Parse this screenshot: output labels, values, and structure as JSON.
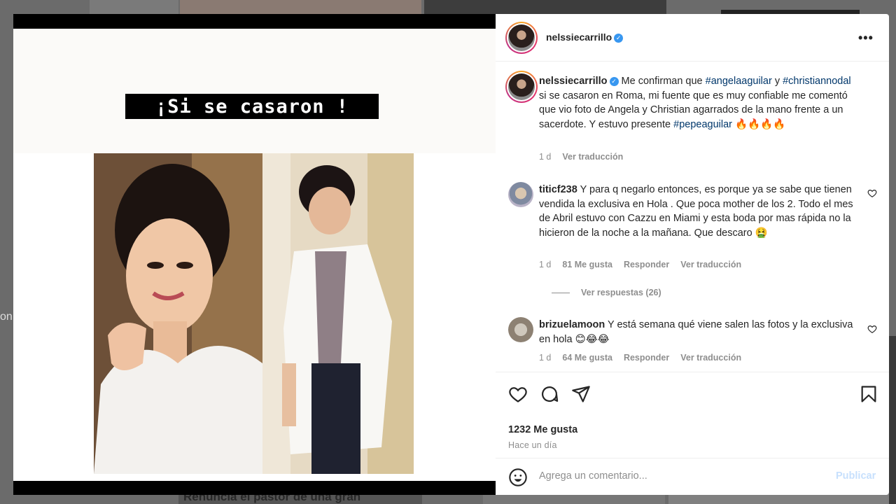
{
  "background": {
    "left_text": "on",
    "bottom_text": "Renuncia el pastor de una gran"
  },
  "media": {
    "story_caption": "¡Si se casaron !"
  },
  "post": {
    "author": "nelssiecarrillo",
    "caption": {
      "username": "nelssiecarrillo",
      "text_1": " Me confirman que ",
      "tag_1": "#angelaaguilar",
      "text_2": " y ",
      "tag_2": "#christiannodal",
      "text_3": " si se casaron en Roma, mi fuente que es muy confiable me comentó que vio foto de Angela y Christian agarrados de la mano frente a un sacerdote. Y estuvo presente ",
      "tag_3": "#pepeaguilar",
      "emoji": " 🔥🔥🔥🔥",
      "time": "1 d",
      "translate": "Ver traducción"
    },
    "comments": [
      {
        "username": "titicf238",
        "text": " Y para q negarlo entonces, es porque ya se sabe que tienen vendida la exclusiva en Hola . Que poca mother de los 2. Todo el mes de Abril estuvo con Cazzu en Miami y esta boda por mas rápida no la hicieron de la noche a la mañana. Que descaro 🤮",
        "time": "1 d",
        "likes": "81 Me gusta",
        "reply": "Responder",
        "translate": "Ver traducción",
        "view_replies": "Ver respuestas (26)"
      },
      {
        "username": "brizuelamoon",
        "text": " Y está semana qué viene salen las fotos y la exclusiva en hola 😊😂😂",
        "time": "1 d",
        "likes": "64 Me gusta",
        "reply": "Responder",
        "translate": "Ver traducción"
      }
    ],
    "likes": "1232 Me gusta",
    "time_ago": "Hace un día"
  },
  "comment_box": {
    "placeholder": "Agrega un comentario...",
    "publish_label": "Publicar"
  },
  "icons": {
    "more": "more-icon",
    "like": "heart-icon",
    "comment": "comment-icon",
    "share": "send-icon",
    "save": "bookmark-icon",
    "emoji": "smiley-icon"
  },
  "colors": {
    "link": "#00376b",
    "verified": "#3897f0",
    "muted": "#8e8e8e",
    "publish_disabled": "#c7e0fd"
  }
}
